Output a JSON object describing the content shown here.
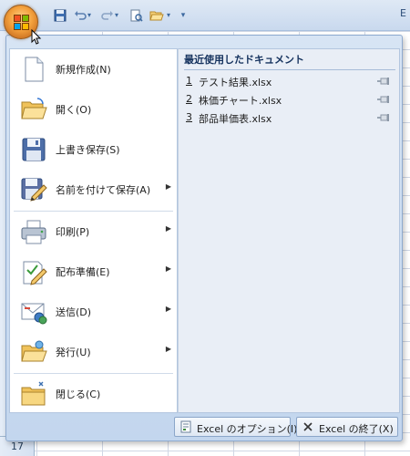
{
  "title_bar": {
    "qat_more": "»",
    "right_text": "E"
  },
  "row_header": {
    "row_number": "17"
  },
  "menu": {
    "items": [
      {
        "label": "新規作成(N)",
        "icon": "new-document-icon",
        "has_submenu": false
      },
      {
        "label": "開く(O)",
        "icon": "open-folder-icon",
        "has_submenu": false
      },
      {
        "label": "上書き保存(S)",
        "icon": "save-disk-icon",
        "has_submenu": false
      },
      {
        "label": "名前を付けて保存(A)",
        "icon": "save-as-icon",
        "has_submenu": true
      },
      {
        "label": "印刷(P)",
        "icon": "printer-icon",
        "has_submenu": true
      },
      {
        "label": "配布準備(E)",
        "icon": "prepare-icon",
        "has_submenu": true
      },
      {
        "label": "送信(D)",
        "icon": "send-icon",
        "has_submenu": true
      },
      {
        "label": "発行(U)",
        "icon": "publish-icon",
        "has_submenu": true
      },
      {
        "label": "閉じる(C)",
        "icon": "close-folder-icon",
        "has_submenu": false
      }
    ],
    "submenu_arrow": "▶"
  },
  "recent": {
    "header": "最近使用したドキュメント",
    "files": [
      {
        "num": "1",
        "name": "テスト結果.xlsx"
      },
      {
        "num": "2",
        "name": "株価チャート.xlsx"
      },
      {
        "num": "3",
        "name": "部品単価表.xlsx"
      }
    ]
  },
  "bottom": {
    "options_label": "Excel のオプション(I)",
    "exit_label": "Excel の終了(X)"
  },
  "colors": {
    "menu_frame": "#c3d6ee",
    "right_pane": "#e9eef6",
    "office_button": "#f3a03c"
  }
}
